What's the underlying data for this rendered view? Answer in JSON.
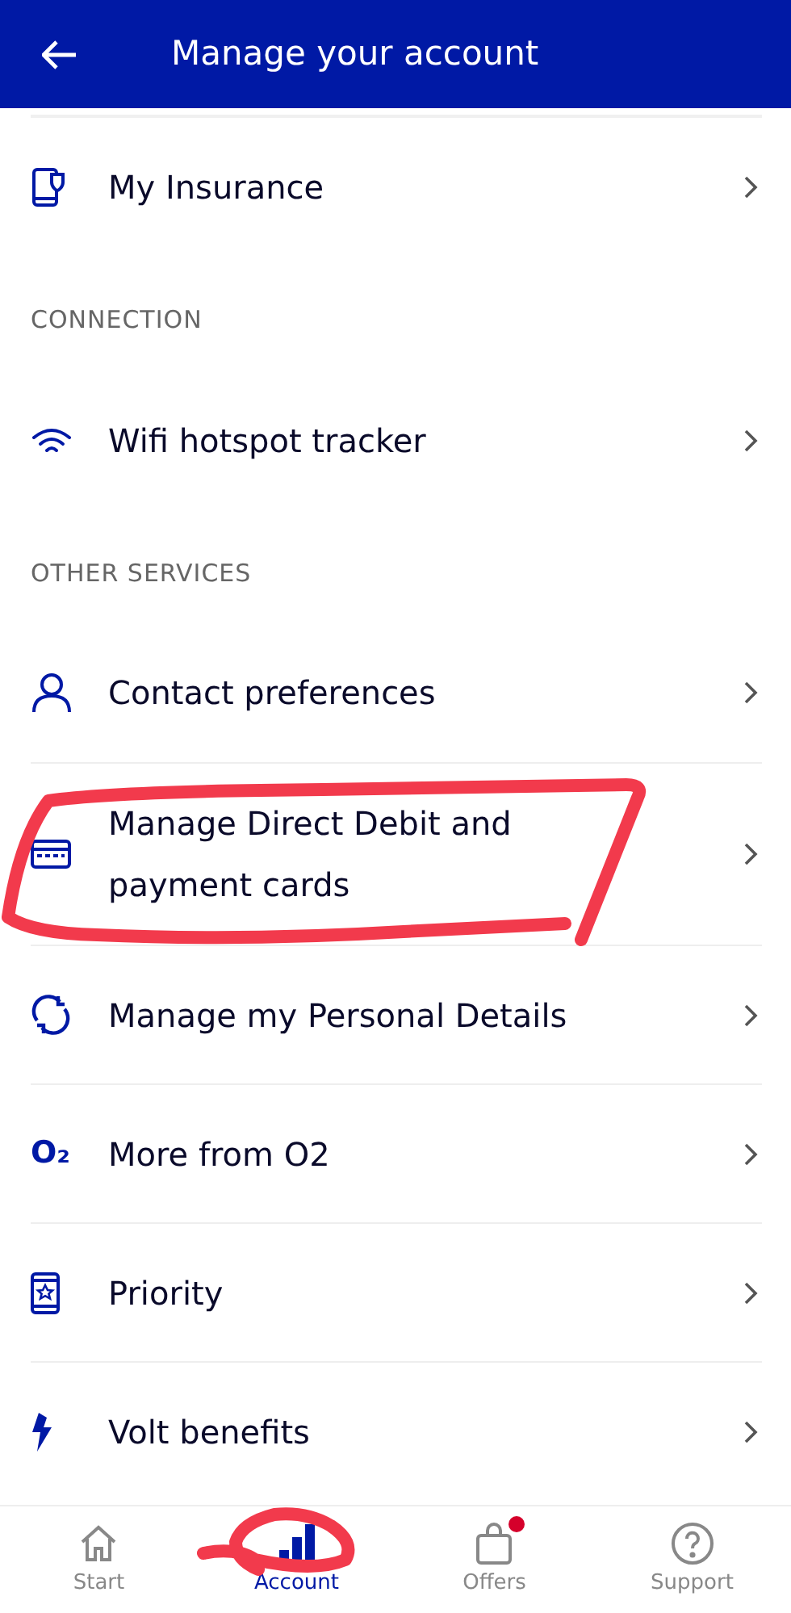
{
  "header": {
    "title": "Manage your account"
  },
  "sections": [
    {
      "items": [
        {
          "label": "My Insurance"
        }
      ]
    },
    {
      "heading": "CONNECTION",
      "items": [
        {
          "label": "Wifi hotspot tracker"
        }
      ]
    },
    {
      "heading": "OTHER SERVICES",
      "items": [
        {
          "label": "Contact preferences"
        },
        {
          "label": "Manage Direct Debit and payment cards"
        },
        {
          "label": "Manage my Personal Details"
        },
        {
          "logo_text": "O₂",
          "label": "More from O2"
        },
        {
          "label": "Priority"
        },
        {
          "label": "Volt benefits"
        }
      ]
    }
  ],
  "bottom_nav": [
    {
      "label": "Start",
      "selected": false,
      "badge": false
    },
    {
      "label": "Account",
      "selected": true,
      "badge": false
    },
    {
      "label": "Offers",
      "selected": false,
      "badge": true
    },
    {
      "label": "Support",
      "selected": false,
      "badge": false
    }
  ]
}
